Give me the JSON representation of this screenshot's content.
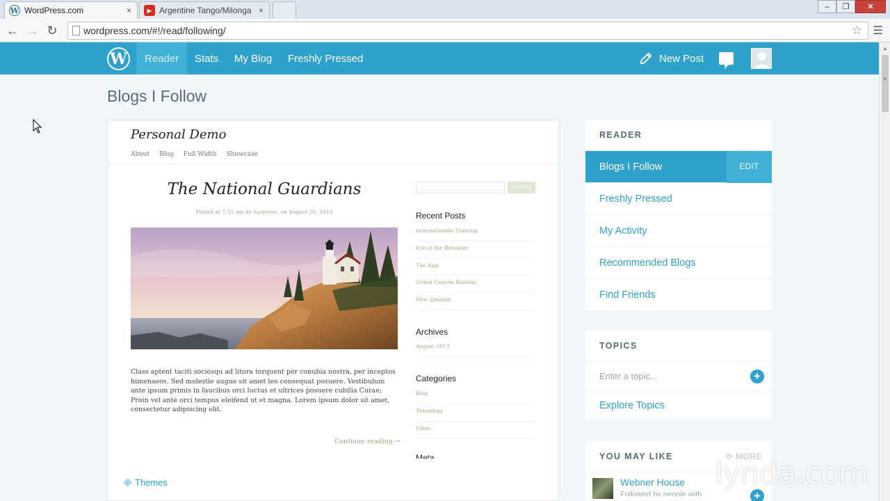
{
  "browser": {
    "tabs": [
      {
        "title": "WordPress.com",
        "close": "×"
      },
      {
        "title": "Argentine Tango/Milonga",
        "close": "×"
      }
    ],
    "url": "wordpress.com/#!/read/following/"
  },
  "masterbar": {
    "items": [
      "Reader",
      "Stats",
      "My Blog",
      "Freshly Pressed"
    ],
    "new_post": "New Post",
    "accent": "#2ea2cc"
  },
  "main": {
    "title": "Blogs I Follow",
    "post": {
      "site_name": "Personal Demo",
      "site_nav": [
        "About",
        "Blog",
        "Full Width",
        "Showcase"
      ],
      "title": "The National Guardians",
      "meta_prefix": "Posted at 7:15 am by ",
      "meta_author": "harperes",
      "meta_suffix": ", on August 26, 2013",
      "body": "Class aptent taciti sociosqu ad litora torquent per conubia nostra, per inceptos himenaeos. Sed molestie augue sit amet leo consequat posuere. Vestibulum ante ipsum primis in faucibus orci luctus et ultrices posuere cubilia Curae; Proin vel ante orci tempus eleifend ut et magna. Lorem ipsum dolor sit amet, consectetur adipiscing elit.",
      "continue": "Continue reading →",
      "tag": "Themes",
      "sidebar": {
        "search_button": "SEARCH",
        "recent_heading": "Recent Posts",
        "recent": [
          "Internationale Training",
          "Eye of the Beholder",
          "The Alps",
          "Grand Canyon Railway",
          "New Zealand"
        ],
        "archives_heading": "Archives",
        "archives": [
          "August 2013"
        ],
        "categories_heading": "Categories",
        "categories": [
          "Blog",
          "Travelling",
          "Video"
        ],
        "meta_heading": "Meta"
      }
    }
  },
  "reader": {
    "heading": "READER",
    "selected": "Blogs I Follow",
    "edit": "EDIT",
    "items": [
      "Freshly Pressed",
      "My Activity",
      "Recommended Blogs",
      "Find Friends"
    ]
  },
  "topics": {
    "heading": "TOPICS",
    "placeholder": "Enter a topic...",
    "explore": "Explore Topics"
  },
  "you_may_like": {
    "heading": "YOU MAY LIKE",
    "more": "MORE",
    "item_name": "Webner House",
    "item_sub": "Followed by people with"
  },
  "watermark": "lynda.com"
}
